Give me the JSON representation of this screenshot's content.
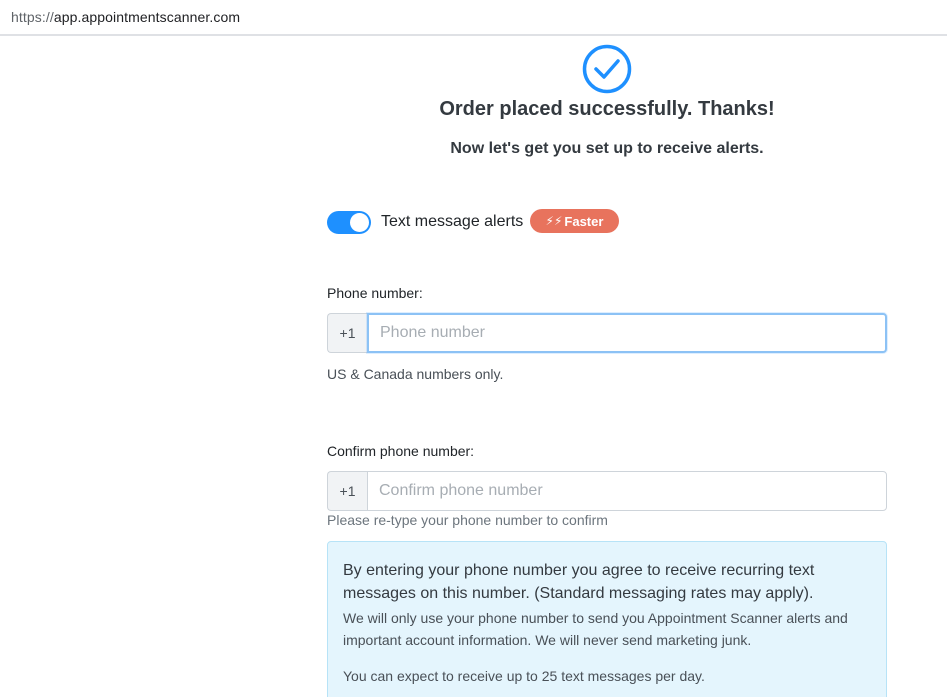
{
  "browser": {
    "url_scheme": "https://",
    "url_host": "app.appointmentscanner.com"
  },
  "header": {
    "title": "Order placed successfully. Thanks!",
    "subtitle": "Now let's get you set up to receive alerts."
  },
  "alerts": {
    "toggle_on": true,
    "label": "Text message alerts",
    "badge_icon": "⚡⚡",
    "badge_label": "Faster"
  },
  "phone": {
    "label": "Phone number:",
    "prefix": "+1",
    "placeholder": "Phone number",
    "value": "",
    "help": "US & Canada numbers only."
  },
  "confirm_phone": {
    "label": "Confirm phone number:",
    "prefix": "+1",
    "placeholder": "Confirm phone number",
    "value": "",
    "help": "Please re-type your phone number to confirm"
  },
  "info": {
    "main": "By entering your phone number you agree to receive recurring text messages on this number. (Standard messaging rates may apply).",
    "detail": "We will only use your phone number to send you Appointment Scanner alerts and important account information. We will never send marketing junk.",
    "limit": "You can expect to receive up to 25 text messages per day."
  },
  "colors": {
    "accent": "#1e90ff",
    "badge": "#e8735d",
    "info_bg": "#e4f5fd"
  },
  "icons": {
    "success": "check-circle-icon",
    "bolt": "lightning-bolt-icon"
  }
}
